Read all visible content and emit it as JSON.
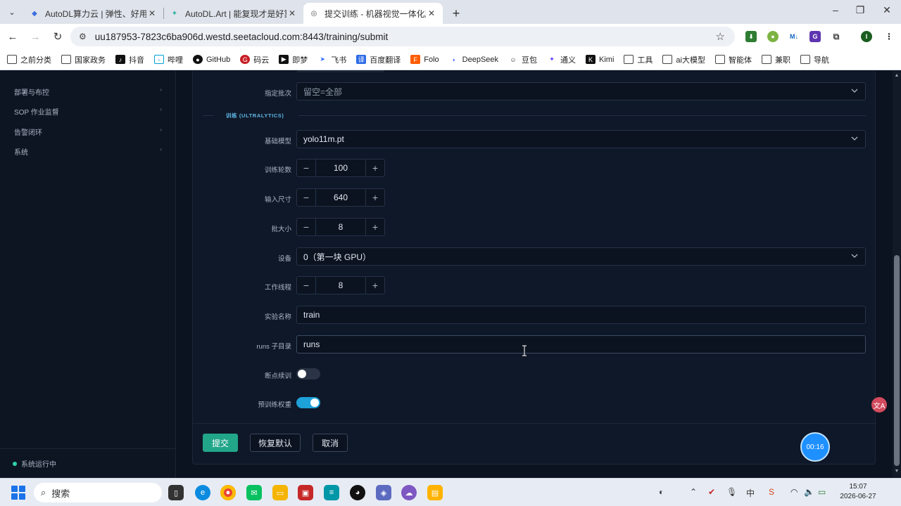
{
  "browser": {
    "tabs": [
      {
        "title": "AutoDL算力云 | 弹性、好用、省钱",
        "active": false
      },
      {
        "title": "AutoDL.Art | 能复现才是好算法",
        "active": false
      },
      {
        "title": "提交训练 - 机器视觉一体化服务",
        "active": true
      }
    ],
    "new_tab": "+",
    "url": "uu187953-7823c6ba906d.westd.seetacloud.com:8443/training/submit",
    "bookmarks": [
      "之前分类",
      "国家政务",
      "抖音",
      "哔哩",
      "GitHub",
      "码云",
      "即梦",
      "飞书",
      "百度翻译",
      "Folo",
      "DeepSeek",
      "豆包",
      "通义",
      "Kimi",
      "工具",
      "ai大模型",
      "智能体",
      "兼职",
      "导航"
    ],
    "profile_initial": "I"
  },
  "sidebar": {
    "items": [
      {
        "label": "部署与布控"
      },
      {
        "label": "SOP 作业监督"
      },
      {
        "label": "告警闭环"
      },
      {
        "label": "系统"
      }
    ],
    "arrow": "›",
    "status": "系统运行中"
  },
  "form": {
    "batch": {
      "label": "指定批次",
      "placeholder": "留空=全部"
    },
    "section_title": "训练 (ULTRALYTICS)",
    "base_model": {
      "label": "基础模型",
      "value": "yolo11m.pt"
    },
    "epochs": {
      "label": "训练轮数",
      "value": "100"
    },
    "imgsz": {
      "label": "输入尺寸",
      "value": "640"
    },
    "batch_size": {
      "label": "批大小",
      "value": "8"
    },
    "device": {
      "label": "设备",
      "value": "0（第一块 GPU）"
    },
    "workers": {
      "label": "工作线程",
      "value": "8"
    },
    "exp_name": {
      "label": "实验名称",
      "value": "train"
    },
    "runs_dir": {
      "label": "runs 子目录",
      "value": "runs"
    },
    "resume": {
      "label": "断点续训",
      "on": false
    },
    "pretrained": {
      "label": "预训练权重",
      "on": true
    },
    "minus": "−",
    "plus": "+"
  },
  "actions": {
    "submit": "提交",
    "reset": "恢复默认",
    "cancel": "取消"
  },
  "timer": "00:16",
  "translate_fab": "文A",
  "taskbar": {
    "search": "搜索",
    "time": "15:07",
    "date": "2026-06-27"
  },
  "colors": {
    "accent": "#22a68a",
    "switch_on": "#1ea0d8",
    "section_title": "#5fb7e6",
    "timer": "#1e90ff"
  }
}
